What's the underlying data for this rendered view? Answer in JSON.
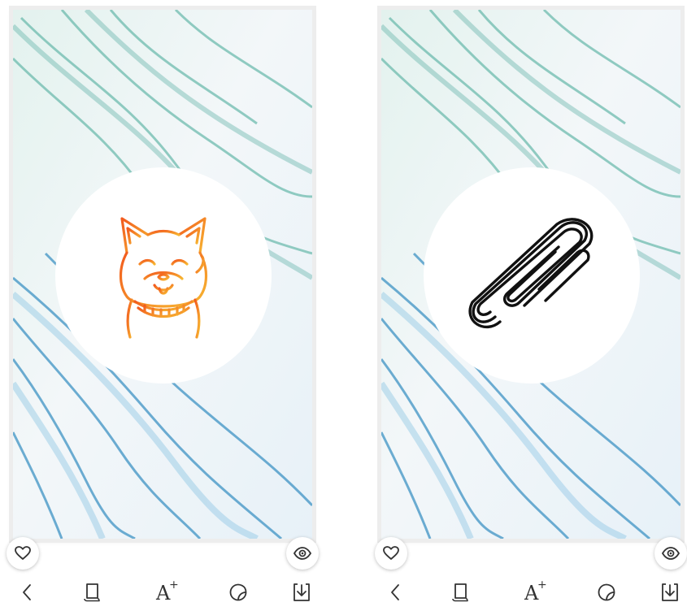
{
  "screens": [
    {
      "id": "left",
      "sticker": "dog-sticker",
      "sticker_color_start": "#f25a1e",
      "sticker_color_end": "#f7b731",
      "icons": {
        "like": "heart-icon",
        "preview": "eye-icon",
        "back": "chevron-left-icon",
        "layer": "layer-icon",
        "add_text": "add-text-icon",
        "sticker": "sticker-icon",
        "download": "download-icon"
      }
    },
    {
      "id": "right",
      "sticker": "paperclip-sticker",
      "sticker_color": "#111111",
      "icons": {
        "like": "heart-icon",
        "preview": "eye-icon",
        "back": "chevron-left-icon",
        "layer": "layer-icon",
        "add_text": "add-text-icon",
        "sticker": "sticker-icon",
        "download": "download-icon"
      }
    }
  ],
  "colors": {
    "marble_base": "#eef4f7",
    "marble_teal": "#5fb5a8",
    "marble_blue": "#3f95c5",
    "icon": "#333333"
  },
  "toolbar": {
    "add_text_glyph": "A",
    "add_text_plus": "+"
  }
}
